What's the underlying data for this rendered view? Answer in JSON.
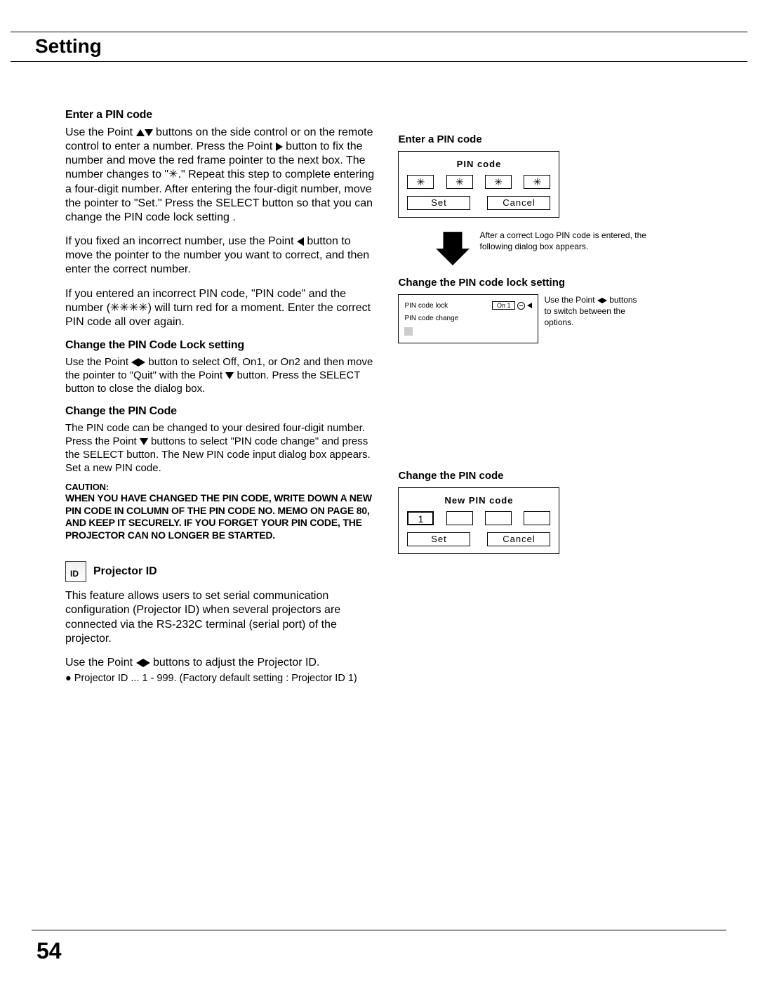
{
  "page": {
    "section_title": "Setting",
    "page_number": "54"
  },
  "left": {
    "sec1_heading": "Enter a PIN code",
    "sec1_p1a": "Use the Point ",
    "sec1_p1b": " buttons on the side control or on the remote control to enter a number.  Press the Point ",
    "sec1_p1c": " button to fix the number and move the red frame pointer to the next box. The number changes to \"✳.\" Repeat this step to complete entering a four-digit number. After entering the four-digit number, move the pointer to \"Set.\" Press the SELECT button so that you can change the PIN code lock setting .",
    "sec1_p2a": " If you fixed an incorrect number, use the Point ",
    "sec1_p2b": " button to move the pointer to the number you want to correct, and then enter the correct number.",
    "sec1_p3": "If you entered an incorrect PIN code, \"PIN code\" and the number (✳✳✳✳) will turn red for a moment. Enter the correct PIN code all over again.",
    "sec2_heading": "Change the PIN Code Lock setting",
    "sec2_p1a": "Use the Point ",
    "sec2_p1b": " button to select Off, On1, or On2 and then move the pointer to \"Quit\" with the Point ",
    "sec2_p1c": " button. Press the SELECT button to close the dialog box.",
    "sec3_heading": "Change the PIN Code",
    "sec3_p1a": "The PIN code can be changed to your desired four-digit number. Press the Point ",
    "sec3_p1b": " buttons to select \"PIN code change\" and press the SELECT button. The New PIN code input dialog box appears. Set a new PIN code.",
    "caution_label": "CAUTION:",
    "caution_body": "WHEN YOU HAVE CHANGED THE PIN CODE, WRITE DOWN A NEW PIN CODE IN COLUMN OF THE PIN CODE NO. MEMO ON PAGE 80, AND KEEP IT SECURELY. IF YOU FORGET YOUR PIN CODE, THE PROJECTOR CAN NO LONGER BE STARTED.",
    "projid_icon_text": "ID",
    "projid_heading": "Projector ID",
    "projid_p1": "This feature allows users to set serial communication configuration (Projector ID) when several projectors are connected via the RS-232C terminal (serial port) of the projector.",
    "projid_p2a": "Use the Point ",
    "projid_p2b": " buttons to adjust the Projector ID.",
    "projid_bullet": "● Projector ID ... 1 - 999. (Factory default setting : Projector ID 1)"
  },
  "right": {
    "enter_label": "Enter a PIN code",
    "pin_title": "PIN  code",
    "star": "✳",
    "set": "Set",
    "cancel": "Cancel",
    "arrow_note": "After a correct Logo PIN code is entered, the following dialog box appears.",
    "lock_label": "Change the PIN code lock setting",
    "lock_row1": "PIN  code  lock",
    "lock_row1_val": "On 1",
    "lock_row2": "PIN  code  change",
    "lock_note_a": "Use the Point ",
    "lock_note_b": " buttons to switch between the options.",
    "change_label": "Change the PIN code",
    "new_pin_title": "New PIN  code",
    "digit1": "1"
  }
}
